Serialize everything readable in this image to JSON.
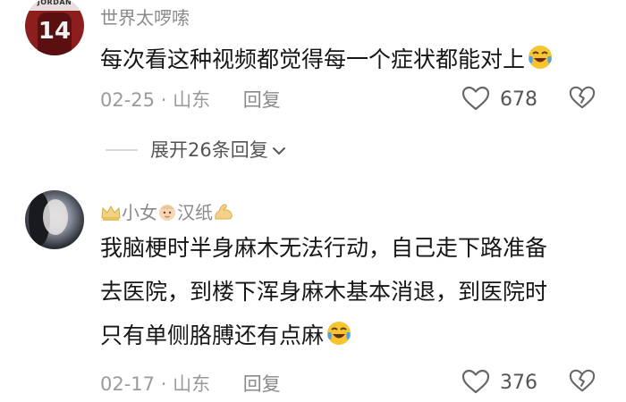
{
  "comments": [
    {
      "username": "世界太啰嗦",
      "avatar_text": "JORDAN",
      "avatar_number": "14",
      "content_lines": [
        "每次看这种视频都觉得每一个症状都能对上"
      ],
      "date": "02-25",
      "location": "山东",
      "reply_label": "回复",
      "likes": "678",
      "expand_label": "展开26条回复"
    },
    {
      "username_parts": [
        "小女",
        "汉纸"
      ],
      "content_lines": [
        "我脑梗时半身麻木无法行动，自己走下路准备",
        "去医院，到楼下浑身麻木基本消退，到医院时",
        "只有单侧胳膊还有点麻"
      ],
      "date": "02-17",
      "location": "山东",
      "reply_label": "回复",
      "likes": "376"
    }
  ],
  "separator": "·",
  "icons": [
    "crown-icon",
    "baby-face-icon",
    "flexed-biceps-icon",
    "laughing-tears-emoji",
    "heart-outline-icon",
    "broken-heart-icon",
    "chevron-down-icon"
  ],
  "colors": {
    "text": "#161616",
    "muted": "#9a9a9a",
    "emoji_yellow": "#f7c531",
    "tear_blue": "#4fa3e8"
  }
}
